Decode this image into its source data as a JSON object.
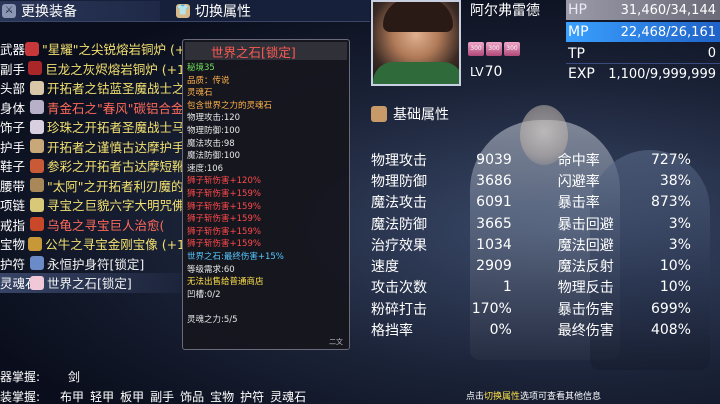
{
  "tabs": {
    "equip": "更换装备",
    "attr": "切换属性"
  },
  "equipment": [
    {
      "slot": "武器",
      "name": "\"星耀\"之尖锐熔岩铜炉 (+1",
      "color": "yellow",
      "icon_color": "#c8383a"
    },
    {
      "slot": "副手",
      "name": "巨龙之灰烬熔岩铜炉 (+1",
      "color": "yellow",
      "icon_color": "#a8282a"
    },
    {
      "slot": "头部",
      "name": "开拓者之钴蓝圣魔战士之",
      "color": "yellow",
      "icon_color": "#d8c8a8"
    },
    {
      "slot": "身体",
      "name": "青金石之\"春风\"碳铝合金",
      "color": "red",
      "icon_color": "#b8b0c8"
    },
    {
      "slot": "饰子",
      "name": "珍珠之开拓者圣魔战士马",
      "color": "yellow",
      "icon_color": "#d8d0e0"
    },
    {
      "slot": "护手",
      "name": "开拓者之谨慎古达摩护手",
      "color": "yellow",
      "icon_color": "#c8a878"
    },
    {
      "slot": "鞋子",
      "name": "参彩之开拓者古达摩短靴",
      "color": "yellow",
      "icon_color": "#c85a38"
    },
    {
      "slot": "腰带",
      "name": "\"太阿\"之开拓者利刃魔的",
      "color": "yellow",
      "icon_color": "#a88858"
    },
    {
      "slot": "项链",
      "name": "寻宝之巨貌六字大明咒佛",
      "color": "yellow",
      "icon_color": "#d8c878"
    },
    {
      "slot": "戒指",
      "name": "乌龟之寻宝巨人治愈(",
      "color": "red",
      "icon_color": "#c84828"
    },
    {
      "slot": "宝物",
      "name": "公牛之寻宝金刚宝像 (+1",
      "color": "yellow",
      "icon_color": "#c89838"
    },
    {
      "slot": "护符",
      "name": "永恒护身符[锁定]",
      "color": "white",
      "icon_color": "#6a8ac8"
    },
    {
      "slot": "灵魂石",
      "name": "世界之石[锁定]",
      "color": "white",
      "icon_color": "#f0c8d8",
      "selected": true
    }
  ],
  "tooltip": {
    "title": "世界之石[锁定]",
    "lines": [
      {
        "text": "秘境35",
        "color": "green"
      },
      {
        "text": "品质：传说",
        "color": "orange"
      },
      {
        "text": "灵魂石",
        "color": "orange"
      },
      {
        "text": "包含世界之力的灵魂石",
        "color": "orange"
      },
      {
        "text": "物理攻击:120",
        "color": "white"
      },
      {
        "text": "物理防御:100",
        "color": "white"
      },
      {
        "text": "魔法攻击:98",
        "color": "white"
      },
      {
        "text": "魔法防御:100",
        "color": "white"
      },
      {
        "text": "速度:106",
        "color": "white"
      },
      {
        "text": "狮子斩伤害+120%",
        "color": "red"
      },
      {
        "text": "狮子斩伤害+159%",
        "color": "red"
      },
      {
        "text": "狮子斩伤害+159%",
        "color": "red"
      },
      {
        "text": "狮子斩伤害+159%",
        "color": "red"
      },
      {
        "text": "狮子斩伤害+159%",
        "color": "red"
      },
      {
        "text": "狮子斩伤害+159%",
        "color": "red"
      },
      {
        "text": "世界之石:最终伤害+15%",
        "color": "cyan"
      },
      {
        "text": "等级需求:60",
        "color": "white"
      },
      {
        "text": "无法出售给普通商店",
        "color": "yellow"
      },
      {
        "text": "凹槽:0/2",
        "color": "white"
      },
      {
        "text": "",
        "color": "white"
      },
      {
        "text": "灵魂之力:5/5",
        "color": "white"
      }
    ],
    "footer": "二文"
  },
  "hero": {
    "name": "阿尔弗雷德",
    "level_label": "LV",
    "level": "70",
    "buffs": [
      "300",
      "300",
      "300"
    ],
    "hp_label": "HP",
    "hp": "31,460/34,144",
    "mp_label": "MP",
    "mp": "22,468/26,161",
    "tp_label": "TP",
    "tp": "0",
    "exp_label": "EXP",
    "exp": "1,100/9,999,999"
  },
  "section_title": "基础属性",
  "stats": [
    {
      "k1": "物理攻击",
      "v1": "9039",
      "k2": "命中率",
      "v2": "727%"
    },
    {
      "k1": "物理防御",
      "v1": "3686",
      "k2": "闪避率",
      "v2": "38%"
    },
    {
      "k1": "魔法攻击",
      "v1": "6091",
      "k2": "暴击率",
      "v2": "873%"
    },
    {
      "k1": "魔法防御",
      "v1": "3665",
      "k2": "暴击回避",
      "v2": "3%"
    },
    {
      "k1": "治疗效果",
      "v1": "1034",
      "k2": "魔法回避",
      "v2": "3%"
    },
    {
      "k1": "速度",
      "v1": "2909",
      "k2": "魔法反射",
      "v2": "10%"
    },
    {
      "k1": "攻击次数",
      "v1": "1",
      "k2": "物理反击",
      "v2": "10%"
    },
    {
      "k1": "粉碎打击",
      "v1": "170%",
      "k2": "暴击伤害",
      "v2": "699%"
    },
    {
      "k1": "格挡率",
      "v1": "0%",
      "k2": "最终伤害",
      "v2": "408%"
    }
  ],
  "mastery": {
    "label": "器掌握:",
    "value": "剑"
  },
  "slots": {
    "label": "装掌握:",
    "items": [
      "布甲",
      "轻甲",
      "板甲",
      "副手",
      "饰品",
      "宝物",
      "护符",
      "灵魂石"
    ]
  },
  "hint": {
    "pre": "点击",
    "highlight": "切换属性",
    "post": "选项可查看其他信息"
  },
  "colors": {
    "equip_yellow": "#f2e070",
    "equip_red": "#ff6a5a",
    "mp_bar": "#3aa0ff",
    "hp_bar": "#9a9aa8"
  }
}
